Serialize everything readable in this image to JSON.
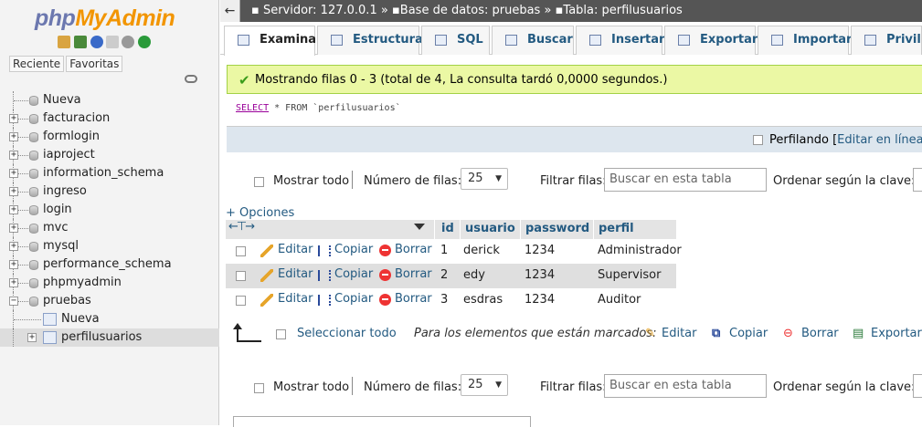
{
  "sidebar": {
    "logo_php": "php",
    "logo_myadmin": "MyAdmin",
    "tab_recent": "Reciente",
    "tab_favorites": "Favoritas",
    "tree": [
      {
        "label": "Nueva",
        "type": "new"
      },
      {
        "label": "facturacion",
        "type": "db"
      },
      {
        "label": "formlogin",
        "type": "db"
      },
      {
        "label": "iaproject",
        "type": "db"
      },
      {
        "label": "information_schema",
        "type": "db"
      },
      {
        "label": "ingreso",
        "type": "db"
      },
      {
        "label": "login",
        "type": "db"
      },
      {
        "label": "mvc",
        "type": "db"
      },
      {
        "label": "mysql",
        "type": "db"
      },
      {
        "label": "performance_schema",
        "type": "db"
      },
      {
        "label": "phpmyadmin",
        "type": "db"
      },
      {
        "label": "pruebas",
        "type": "db-open"
      },
      {
        "label": "Nueva",
        "type": "sub-new"
      },
      {
        "label": "perfilusuarios",
        "type": "sub-table-selected"
      }
    ]
  },
  "breadcrumb": {
    "server": "Servidor: 127.0.0.1",
    "database": "Base de datos: pruebas",
    "table": "Tabla: perfilusuarios",
    "sep": "»"
  },
  "tabs": [
    "Examinar",
    "Estructura",
    "SQL",
    "Buscar",
    "Insertar",
    "Exportar",
    "Importar",
    "Privileg"
  ],
  "message": "Mostrando filas 0 - 3 (total de 4, La consulta tardó 0,0000 segundos.)",
  "sql": {
    "select": "SELECT",
    "rest": " * FROM `perfilusuarios`"
  },
  "profiling": {
    "label": "Perfilando",
    "edit_inline": "Editar en línea",
    "bracket_open": "[",
    "bracket_sep": "] ["
  },
  "nav": {
    "show_all": "Mostrar todo",
    "rows_label": "Número de filas:",
    "rows_value": "25",
    "filter_label": "Filtrar filas:",
    "filter_placeholder": "Buscar en esta tabla",
    "sort_label": "Ordenar según la clave:"
  },
  "options_label": "+ Opciones",
  "table": {
    "columns": [
      "id",
      "usuario",
      "password",
      "perfil"
    ],
    "actions": {
      "edit": "Editar",
      "copy": "Copiar",
      "delete": "Borrar"
    },
    "rows": [
      {
        "id": "1",
        "usuario": "derick",
        "password": "1234",
        "perfil": "Administrador"
      },
      {
        "id": "2",
        "usuario": "edy",
        "password": "1234",
        "perfil": "Supervisor"
      },
      {
        "id": "3",
        "usuario": "esdras",
        "password": "1234",
        "perfil": "Auditor"
      }
    ]
  },
  "bulk": {
    "select_all": "Seleccionar todo",
    "for_marked": "Para los elementos que están marcados:",
    "edit": "Editar",
    "copy": "Copiar",
    "delete": "Borrar",
    "export": "Exportar"
  },
  "colors": {
    "accent_link": "#235a81",
    "success_bg": "#ebf8a4",
    "topbar": "#555555"
  }
}
